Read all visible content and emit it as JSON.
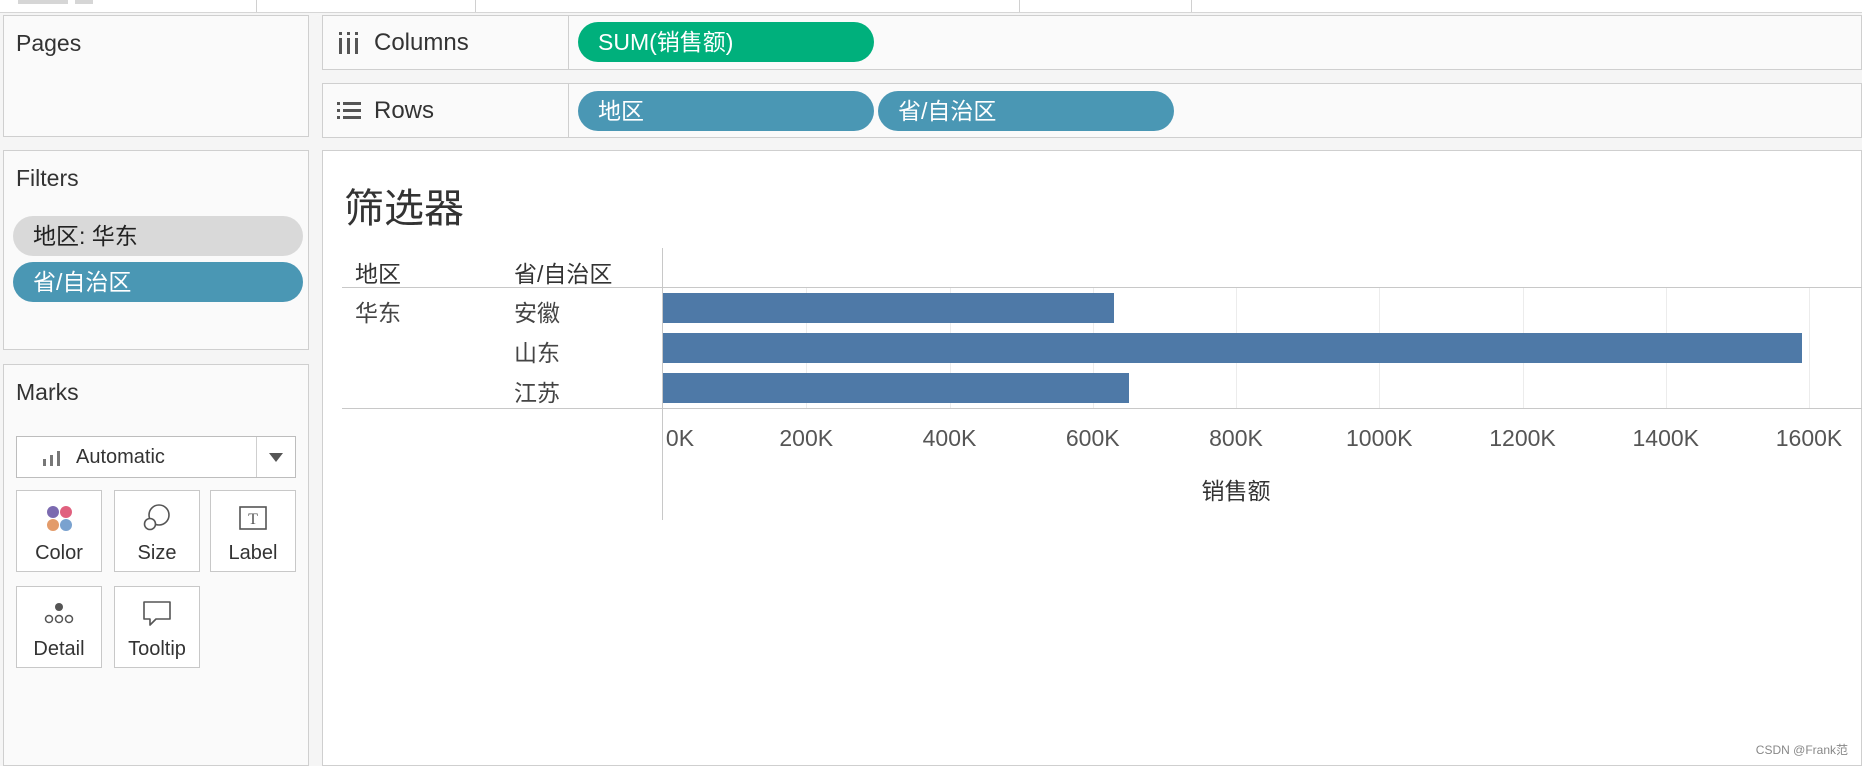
{
  "pages": {
    "title": "Pages"
  },
  "filters": {
    "title": "Filters",
    "items": [
      {
        "label": "地区: 华东",
        "color": "#d9d9d9"
      },
      {
        "label": "省/自治区",
        "color": "#4a97b4"
      }
    ]
  },
  "marks": {
    "title": "Marks",
    "type_selected": "Automatic",
    "buttons": [
      {
        "label": "Color",
        "icon": "color-dots-icon"
      },
      {
        "label": "Size",
        "icon": "size-circles-icon"
      },
      {
        "label": "Label",
        "icon": "label-text-icon"
      },
      {
        "label": "Detail",
        "icon": "detail-dots-icon"
      },
      {
        "label": "Tooltip",
        "icon": "tooltip-bubble-icon"
      }
    ]
  },
  "shelves": {
    "columns": {
      "label": "Columns",
      "pills": [
        "SUM(销售额)"
      ]
    },
    "rows": {
      "label": "Rows",
      "pills": [
        "地区",
        "省/自治区"
      ]
    }
  },
  "colors": {
    "measure_pill": "#00b07c",
    "dimension_pill": "#4a97b4",
    "bar": "#4e79a7"
  },
  "sheet": {
    "title": "筛选器",
    "headers": {
      "col1": "地区",
      "col2": "省/自治区"
    },
    "region": "华东"
  },
  "chart_data": {
    "type": "bar",
    "orientation": "horizontal",
    "categories": [
      "安徽",
      "山东",
      "江苏"
    ],
    "values": [
      630000,
      1590000,
      650000
    ],
    "xlabel": "销售额",
    "xlim": [
      0,
      1600000
    ],
    "ticks": [
      "0K",
      "200K",
      "400K",
      "600K",
      "800K",
      "1000K",
      "1200K",
      "1400K",
      "1600K"
    ],
    "tick_values": [
      0,
      200000,
      400000,
      600000,
      800000,
      1000000,
      1200000,
      1400000,
      1600000
    ],
    "grid": true
  },
  "watermark": "CSDN @Frank范"
}
